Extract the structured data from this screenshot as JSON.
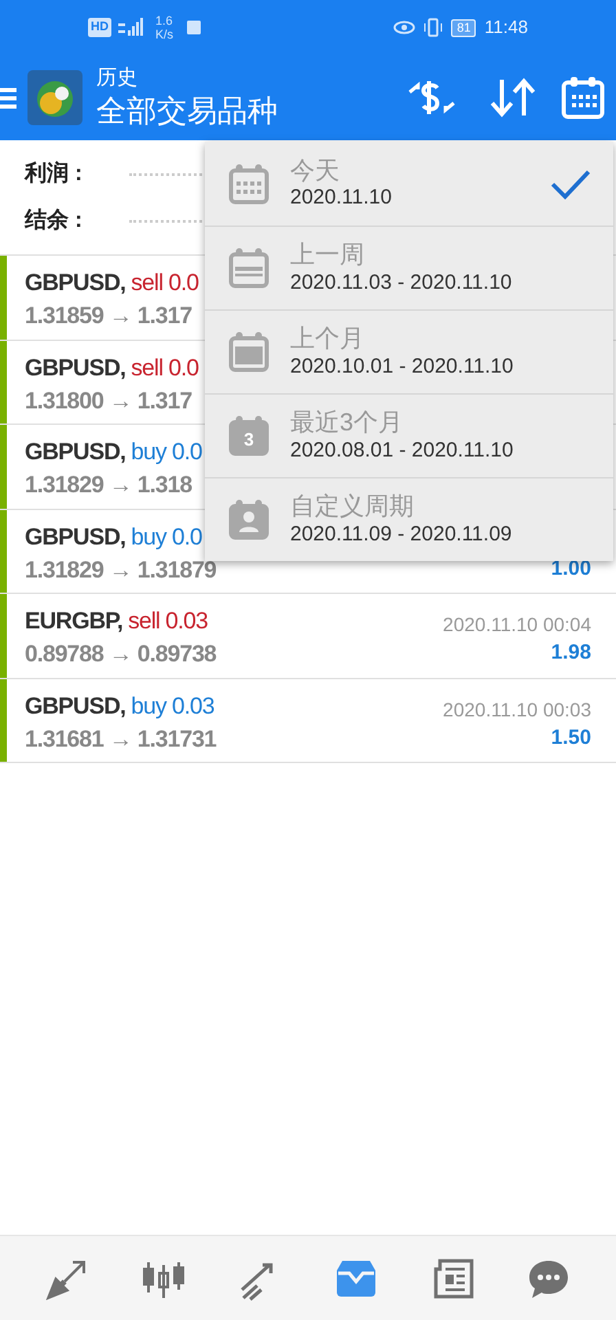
{
  "status_bar": {
    "hd": "HD",
    "speed": "1.6",
    "speed_unit": "K/s",
    "battery": "81",
    "time": "11:48"
  },
  "toolbar": {
    "title": "历史",
    "subtitle": "全部交易品种"
  },
  "summary": [
    {
      "label": "利润 :"
    },
    {
      "label": "结余 :"
    }
  ],
  "deals": [
    {
      "symbol": "GBPUSD,",
      "side": "sell 0.0",
      "kind": "sell",
      "prices": "1.31859 → 1.317"
    },
    {
      "symbol": "GBPUSD,",
      "side": "sell 0.0",
      "kind": "sell",
      "prices": "1.31800 → 1.317"
    },
    {
      "symbol": "GBPUSD,",
      "side": "buy 0.0",
      "kind": "buy",
      "prices": "1.31829 → 1.318"
    },
    {
      "symbol": "GBPUSD,",
      "side": "buy 0.0",
      "kind": "buy",
      "prices": "1.31829 → 1.31879",
      "profit": "1.00"
    },
    {
      "symbol": "EURGBP,",
      "side": "sell 0.03",
      "kind": "sell",
      "prices": "0.89788 → 0.89738",
      "time": "2020.11.10 00:04",
      "profit": "1.98"
    },
    {
      "symbol": "GBPUSD,",
      "side": "buy 0.03",
      "kind": "buy",
      "prices": "1.31681 → 1.31731",
      "time": "2020.11.10 00:03",
      "profit": "1.50"
    }
  ],
  "period_menu": [
    {
      "kind": "day",
      "title": "今天",
      "range": "2020.11.10",
      "selected": true
    },
    {
      "kind": "week",
      "title": "上一周",
      "range": "2020.11.03 - 2020.11.10",
      "selected": false
    },
    {
      "kind": "month",
      "title": "上个月",
      "range": "2020.10.01 - 2020.11.10",
      "selected": false
    },
    {
      "kind": "number",
      "title": "最近3个月",
      "range": "2020.08.01 - 2020.11.10",
      "icon_text": "3",
      "selected": false
    },
    {
      "kind": "custom",
      "title": "自定义周期",
      "range": "2020.11.09 - 2020.11.09",
      "selected": false
    }
  ],
  "bottom_nav": [
    {
      "kind": "quotes",
      "selected": false
    },
    {
      "kind": "chart",
      "selected": false
    },
    {
      "kind": "trade",
      "selected": false
    },
    {
      "kind": "history",
      "selected": true
    },
    {
      "kind": "news",
      "selected": false
    },
    {
      "kind": "chat",
      "selected": false
    }
  ]
}
